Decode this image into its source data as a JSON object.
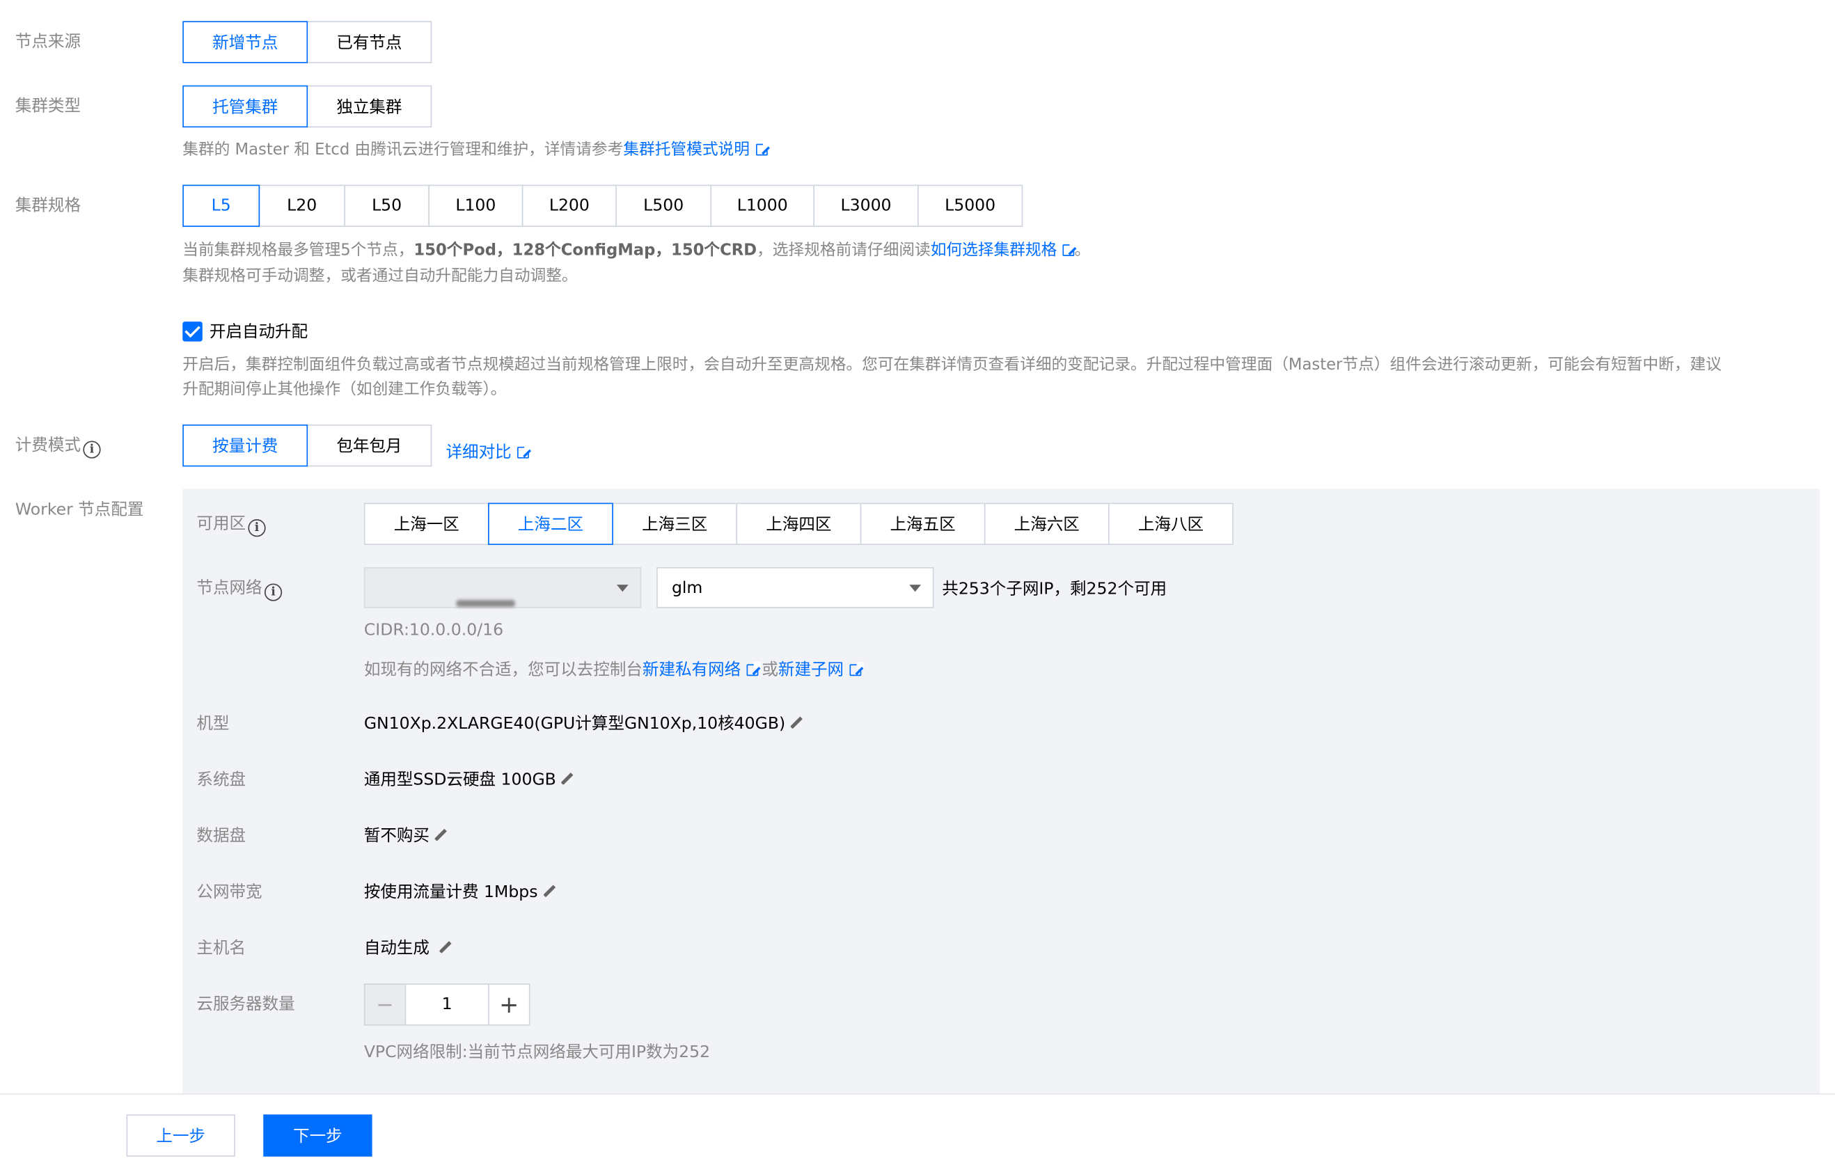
{
  "node_source": {
    "label": "节点来源",
    "options": [
      "新增节点",
      "已有节点"
    ],
    "selected": 0
  },
  "cluster_type": {
    "label": "集群类型",
    "options": [
      "托管集群",
      "独立集群"
    ],
    "selected": 0,
    "desc_prefix": "集群的 Master 和 Etcd 由腾讯云进行管理和维护，详情请参考",
    "desc_link": "集群托管模式说明"
  },
  "cluster_spec": {
    "label": "集群规格",
    "options": [
      "L5",
      "L20",
      "L50",
      "L100",
      "L200",
      "L500",
      "L1000",
      "L3000",
      "L5000"
    ],
    "selected": 0,
    "desc_a": "当前集群规格最多管理5个节点，",
    "desc_bold": "150个Pod，128个ConfigMap，150个CRD",
    "desc_b": "，选择规格前请仔细阅读",
    "desc_link": "如何选择集群规格",
    "desc_end": "。",
    "desc_line2": "集群规格可手动调整，或者通过自动升配能力自动调整。"
  },
  "auto_upgrade": {
    "label": "开启自动升配",
    "checked": true,
    "desc_line1": "开启后，集群控制面组件负载过高或者节点规模超过当前规格管理上限时，会自动升至更高规格。您可在集群详情页查看详细的变配记录。升配过程中管理面（Master节点）组件会进行滚动更新，可能会有短暂中断，建议",
    "desc_line2": "升配期间停止其他操作（如创建工作负载等）。"
  },
  "billing": {
    "label": "计费模式",
    "options": [
      "按量计费",
      "包年包月"
    ],
    "selected": 0,
    "compare_link": "详细对比"
  },
  "worker": {
    "label": "Worker 节点配置",
    "zone": {
      "label": "可用区",
      "options": [
        "上海一区",
        "上海二区",
        "上海三区",
        "上海四区",
        "上海五区",
        "上海六区",
        "上海八区"
      ],
      "selected": 1
    },
    "network": {
      "label": "节点网络",
      "vpc_value": "",
      "subnet_value": "glm",
      "subnet_info": "共253个子网IP，剩252个可用",
      "cidr": "CIDR:10.0.0.0/16",
      "hint_prefix": "如现有的网络不合适，您可以去控制台",
      "hint_link1": "新建私有网络",
      "hint_or": "或",
      "hint_link2": "新建子网"
    },
    "model": {
      "label": "机型",
      "value": "GN10Xp.2XLARGE40(GPU计算型GN10Xp,10核40GB)"
    },
    "system_disk": {
      "label": "系统盘",
      "value": "通用型SSD云硬盘 100GB"
    },
    "data_disk": {
      "label": "数据盘",
      "value": "暂不购买"
    },
    "bandwidth": {
      "label": "公网带宽",
      "value": "按使用流量计费 1Mbps"
    },
    "hostname": {
      "label": "主机名",
      "value": "自动生成"
    },
    "count": {
      "label": "云服务器数量",
      "value": "1",
      "minus": "−",
      "plus": "+"
    },
    "vpc_limit": "VPC网络限制:当前节点网络最大可用IP数为252"
  },
  "footer": {
    "prev": "上一步",
    "next": "下一步"
  },
  "colors": {
    "accent": "#006eff",
    "panel_bg": "#f2f3f7",
    "muted": "#888888"
  }
}
